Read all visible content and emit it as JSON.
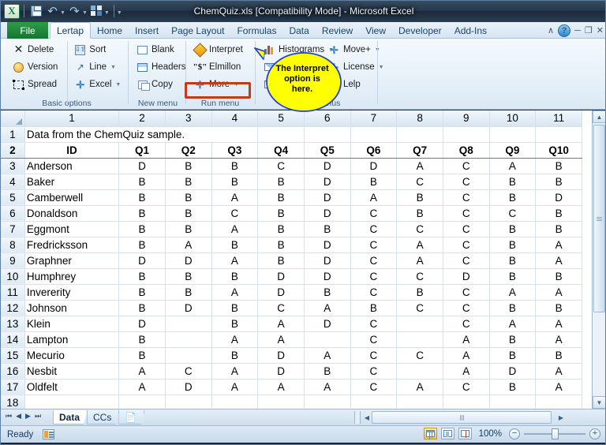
{
  "window": {
    "title": "ChemQuiz.xls  [Compatibility Mode]  -  Microsoft Excel",
    "qat": {
      "logo": "excel-logo",
      "save": "save-icon",
      "undo": "undo-icon",
      "redo": "redo-icon",
      "custom": "custom-macro-icon",
      "customize": "customize-qat-icon"
    },
    "controls": {
      "collapse_ribbon": "∧",
      "help": "?",
      "minimize": "─",
      "restore": "❐",
      "close": "✕"
    }
  },
  "ribbon": {
    "file_tab": "File",
    "tabs": [
      {
        "label": "Lertap",
        "active": true
      },
      {
        "label": "Home",
        "active": false
      },
      {
        "label": "Insert",
        "active": false
      },
      {
        "label": "Page Layout",
        "active": false
      },
      {
        "label": "Formulas",
        "active": false
      },
      {
        "label": "Data",
        "active": false
      },
      {
        "label": "Review",
        "active": false
      },
      {
        "label": "View",
        "active": false
      },
      {
        "label": "Developer",
        "active": false
      },
      {
        "label": "Add-Ins",
        "active": false
      }
    ],
    "groups": [
      {
        "name": "Basic options",
        "columns": [
          [
            {
              "label": "Delete",
              "icon": "delete-x-icon",
              "dropdown": false
            },
            {
              "label": "Version",
              "icon": "smiley-icon",
              "dropdown": false
            },
            {
              "label": "Spread",
              "icon": "spread-icon",
              "dropdown": false
            }
          ],
          [
            {
              "label": "Sort",
              "icon": "sort-icon",
              "dropdown": false
            },
            {
              "label": "Line",
              "icon": "line-chart-icon",
              "dropdown": true
            },
            {
              "label": "Excel",
              "icon": "plus-icon",
              "dropdown": true
            }
          ]
        ]
      },
      {
        "name": "New menu",
        "columns": [
          [
            {
              "label": "Blank",
              "icon": "blank-sheet-icon",
              "dropdown": false
            },
            {
              "label": "Headers",
              "icon": "headers-icon",
              "dropdown": false
            },
            {
              "label": "Copy",
              "icon": "copy-icon",
              "dropdown": false
            }
          ]
        ]
      },
      {
        "name": "Run menu",
        "columns": [
          [
            {
              "label": "Interpret",
              "icon": "interpret-icon",
              "dropdown": false,
              "highlighted": true
            },
            {
              "label": "Elmillon",
              "icon": "dollar-icon",
              "dropdown": false
            },
            {
              "label": "More",
              "icon": "plus-icon",
              "dropdown": true
            }
          ]
        ]
      },
      {
        "name": "Other menus",
        "columns": [
          [
            {
              "label": "Histograms",
              "icon": "histogram-icon",
              "dropdown": true
            },
            {
              "label": "Envelope",
              "icon": "envelope-blue-icon",
              "dropdown": false
            },
            {
              "label": "Envelope2",
              "icon": "envelope-orange-icon",
              "dropdown": false
            }
          ],
          [
            {
              "label": "Move+",
              "icon": "plus-icon",
              "dropdown": true
            },
            {
              "label": "License",
              "icon": "plus-icon",
              "dropdown": true
            },
            {
              "label": "Lelp",
              "icon": "help-icon",
              "dropdown": false
            }
          ]
        ]
      }
    ]
  },
  "callout": {
    "text_lines": [
      "The Interpret",
      "option is",
      "here."
    ],
    "fill_color": "#ffff00",
    "stroke_color": "#1f3fd4"
  },
  "sheet": {
    "column_headers": [
      "1",
      "2",
      "3",
      "4",
      "5",
      "6",
      "7",
      "8",
      "9",
      "10",
      "11"
    ],
    "title_row": {
      "row": "1",
      "text": "Data from the ChemQuiz sample."
    },
    "header_row": {
      "row": "2",
      "cells": [
        "ID",
        "Q1",
        "Q2",
        "Q3",
        "Q4",
        "Q5",
        "Q6",
        "Q7",
        "Q8",
        "Q9",
        "Q10"
      ]
    },
    "rows": [
      {
        "row": "3",
        "cells": [
          "Anderson",
          "D",
          "B",
          "B",
          "C",
          "D",
          "D",
          "A",
          "C",
          "A",
          "B"
        ]
      },
      {
        "row": "4",
        "cells": [
          "Baker",
          "B",
          "B",
          "B",
          "B",
          "D",
          "B",
          "C",
          "C",
          "B",
          "B"
        ]
      },
      {
        "row": "5",
        "cells": [
          "Camberwell",
          "B",
          "B",
          "A",
          "B",
          "D",
          "A",
          "B",
          "C",
          "B",
          "D"
        ]
      },
      {
        "row": "6",
        "cells": [
          "Donaldson",
          "B",
          "B",
          "C",
          "B",
          "D",
          "C",
          "B",
          "C",
          "C",
          "B"
        ]
      },
      {
        "row": "7",
        "cells": [
          "Eggmont",
          "B",
          "B",
          "A",
          "B",
          "B",
          "C",
          "C",
          "C",
          "B",
          "B"
        ]
      },
      {
        "row": "8",
        "cells": [
          "Fredricksson",
          "B",
          "A",
          "B",
          "B",
          "D",
          "C",
          "A",
          "C",
          "B",
          "A"
        ]
      },
      {
        "row": "9",
        "cells": [
          "Graphner",
          "D",
          "D",
          "A",
          "B",
          "D",
          "C",
          "A",
          "C",
          "B",
          "A"
        ]
      },
      {
        "row": "10",
        "cells": [
          "Humphrey",
          "B",
          "B",
          "B",
          "D",
          "D",
          "C",
          "C",
          "D",
          "B",
          "B"
        ]
      },
      {
        "row": "11",
        "cells": [
          "Invererity",
          "B",
          "B",
          "A",
          "D",
          "B",
          "C",
          "B",
          "C",
          "A",
          "A"
        ]
      },
      {
        "row": "12",
        "cells": [
          "Johnson",
          "B",
          "D",
          "B",
          "C",
          "A",
          "B",
          "C",
          "C",
          "B",
          "B"
        ]
      },
      {
        "row": "13",
        "cells": [
          "Klein",
          "D",
          "",
          "B",
          "A",
          "D",
          "C",
          "",
          "C",
          "A",
          "A"
        ]
      },
      {
        "row": "14",
        "cells": [
          "Lampton",
          "B",
          "",
          "A",
          "A",
          "",
          "C",
          "",
          "A",
          "B",
          "A"
        ]
      },
      {
        "row": "15",
        "cells": [
          "Mecurio",
          "B",
          "",
          "B",
          "D",
          "A",
          "C",
          "C",
          "A",
          "B",
          "B"
        ]
      },
      {
        "row": "16",
        "cells": [
          "Nesbit",
          "A",
          "C",
          "A",
          "D",
          "B",
          "C",
          "",
          "A",
          "D",
          "A"
        ]
      },
      {
        "row": "17",
        "cells": [
          "Oldfelt",
          "A",
          "D",
          "A",
          "A",
          "A",
          "C",
          "A",
          "C",
          "B",
          "A"
        ]
      },
      {
        "row": "18",
        "cells": [
          "",
          "",
          "",
          "",
          "",
          "",
          "",
          "",
          "",
          "",
          ""
        ]
      }
    ]
  },
  "sheet_tabs": {
    "nav": [
      "⏮",
      "◀",
      "▶",
      "⏭"
    ],
    "tabs": [
      {
        "label": "Data",
        "active": true
      },
      {
        "label": "CCs",
        "active": false
      },
      {
        "label": "",
        "active": false,
        "icon": "new-sheet-icon"
      }
    ]
  },
  "status": {
    "state": "Ready",
    "macro_icon": "record-macro-icon",
    "views": [
      {
        "name": "normal-view",
        "active": true
      },
      {
        "name": "page-layout-view",
        "active": false
      },
      {
        "name": "page-break-preview",
        "active": false
      }
    ],
    "zoom": "100%",
    "zoom_out": "−",
    "zoom_in": "+"
  }
}
